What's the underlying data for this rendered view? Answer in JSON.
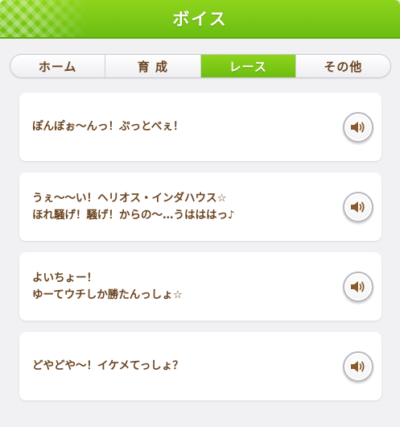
{
  "header": {
    "title": "ボイス"
  },
  "tabs": [
    {
      "label": "ホーム",
      "active": false
    },
    {
      "label": "育 成",
      "active": false
    },
    {
      "label": "レース",
      "active": true
    },
    {
      "label": "その他",
      "active": false
    }
  ],
  "voices": [
    {
      "line1": "ぽんぽぉ〜んっ！ぷっとべぇ！",
      "line2": ""
    },
    {
      "line1": "うぇ〜〜い！ヘリオス・インダハウス☆",
      "line2": "ほれ騒げ！騒げ！からの〜…うはははっ♪"
    },
    {
      "line1": "よいちょー！",
      "line2": "ゆーてウチしか勝たんっしょ☆"
    },
    {
      "line1": "どやどや〜！イケメてっしょ？",
      "line2": ""
    }
  ],
  "icons": {
    "voice_button": "speaker-icon"
  },
  "colors": {
    "accent": "#7cc816",
    "text": "#6b4420",
    "speaker": "#8a5a2b"
  }
}
